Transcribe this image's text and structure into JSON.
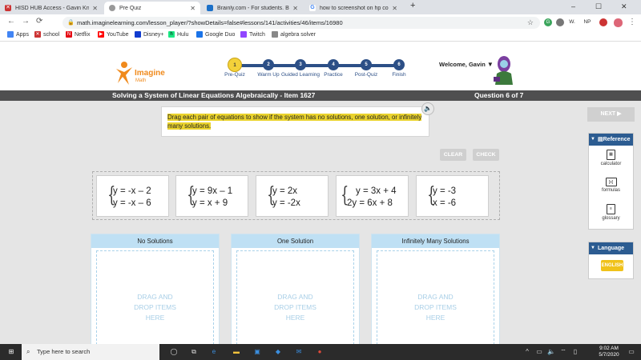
{
  "browser": {
    "tabs": [
      {
        "title": "HISD HUB Access - Gavin Kniss",
        "icon": "hub-icon"
      },
      {
        "title": "Pre Quiz",
        "icon": "imagine-icon",
        "active": true
      },
      {
        "title": "Brainly.com - For students. By st",
        "icon": "brainly-icon"
      },
      {
        "title": "how to screenshot on hp compu",
        "icon": "google-icon"
      }
    ],
    "new_tab": "+",
    "window_controls": [
      "–",
      "☐",
      "✕"
    ],
    "url": "math.imaginelearning.com/lesson_player/?showDetails=false#lessons/141/activities/46/items/16980",
    "extensions": [
      "W.",
      "NP"
    ],
    "bookmarks": [
      "Apps",
      "school",
      "Netflix",
      "YouTube",
      "Disney+",
      "Hulu",
      "Google Duo",
      "Twitch",
      "algebra solver"
    ]
  },
  "header": {
    "logo_title": "Imagine",
    "logo_subtitle": "Math",
    "steps": [
      "Pre-Quiz",
      "Warm Up",
      "Guided Learning",
      "Practice",
      "Post-Quiz",
      "Finish"
    ],
    "step_numbers": [
      "1",
      "2",
      "3",
      "4",
      "5",
      "6"
    ],
    "current_step": 1,
    "welcome": "Welcome, Gavin"
  },
  "titlebar": {
    "lesson": "Solving a System of Linear Equations Algebraically - Item 1627",
    "question": "Question 6 of 7"
  },
  "prompt": {
    "text": "Drag each pair of equations to show if the system has no solutions, one solution, or infinitely many solutions."
  },
  "buttons": {
    "clear": "CLEAR",
    "check": "CHECK",
    "next": "NEXT ▶"
  },
  "tiles": [
    {
      "eq1": "y = -x – 2",
      "eq2": "y = -x – 6"
    },
    {
      "eq1": "y = 9x – 1",
      "eq2": "y = x + 9"
    },
    {
      "eq1": "y = 2x",
      "eq2": "y = -2x"
    },
    {
      "eq1": "y = 3x + 4",
      "eq2": "2y = 6x + 8"
    },
    {
      "eq1": "y = -3",
      "eq2": "x = -6"
    }
  ],
  "zones": [
    {
      "label": "No Solutions",
      "placeholder": "DRAG AND DROP ITEMS HERE"
    },
    {
      "label": "One Solution",
      "placeholder": "DRAG AND DROP ITEMS HERE"
    },
    {
      "label": "Infinitely Many Solutions",
      "placeholder": "DRAG AND DROP ITEMS HERE"
    }
  ],
  "reference": {
    "title": "Reference",
    "items": [
      "calculator",
      "formulas",
      "glossary"
    ]
  },
  "language": {
    "title": "Language",
    "button": "ENGLISH"
  },
  "taskbar": {
    "search_placeholder": "Type here to search",
    "time": "9:02 AM",
    "date": "5/7/2020"
  },
  "colors": {
    "accent": "#2c4f86",
    "highlight": "#ead32d",
    "zone_header": "#bfe0f4",
    "english": "#f0c21a"
  }
}
